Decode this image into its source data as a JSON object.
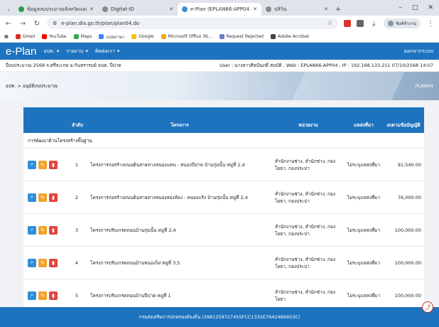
{
  "browser": {
    "tabs": [
      {
        "label": "ข้อมูลงบประมาณจังหวัดและแผนงาน",
        "icon": "globe-icon",
        "active": false
      },
      {
        "label": "Digital-ID",
        "icon": "globe-icon",
        "active": false
      },
      {
        "label": "e-Plan (EPLAN66-APP04)",
        "icon": "globe-icon",
        "active": true
      },
      {
        "label": "ปลิวิน",
        "icon": "globe-icon",
        "active": false
      }
    ],
    "url": "e-plan.dla.go.th/plan/plan04.do",
    "profile_label": "ซิงค์ทำงาน",
    "bookmarks": [
      "Gmail",
      "YouTube",
      "Maps",
      "แปลภาษา",
      "Google",
      "Microsoft Office 36...",
      "Request Rejected",
      "Adobe Acrobat"
    ],
    "new_tab_label": "+"
  },
  "app": {
    "brand": "e-Plan",
    "menu": [
      "อปท.",
      "รายงาน",
      "ติดต่อเรา"
    ],
    "logout": "ออกจากระบบ",
    "fiscal_info": "ปีงบประมาณ 2568   จ.ศรีสะเกษ อ.กันทรารมย์ อบต. ปีปาด",
    "user_info": "User : นางสาวศิลป์นภดี สมบัติ , Web : EPLAN66-APP04 , IP : 192.168.133.211 07/10/2568 14:07",
    "breadcrumb": "อปท. > อนุมัติงบประมาณ",
    "page_code": "PLAN04"
  },
  "table": {
    "headers": {
      "index": "ลำดับ",
      "project": "โครงการ",
      "agency": "หน่วยงาน",
      "source": "แหล่งที่มา",
      "budget": "งบตามข้อบัญญัติ"
    },
    "section": "การพัฒนาด้านโครงสร้างพื้นฐาน",
    "rows": [
      {
        "index": "1",
        "project": "โครงการก่อสร้างถนนดินสายทางหนองแคน - หนองปีปาด บ้านกุ่มนั้น หมู่ที่ 2,4",
        "agency": "สำนักงานช่าง, สำนักช่าง, กองโยธา, กองประปา",
        "source": "ไม่ระบุแหล่งที่มา",
        "budget": "91,540.00"
      },
      {
        "index": "2",
        "project": "โครงการก่อสร้างถนนดินสายทางหนองสองห้อง - หนองแร้ง บ้านกุ่มนั้น หมู่ที่ 2,4",
        "agency": "สำนักงานช่าง, สำนักช่าง, กองโยธา, กองประปา",
        "source": "ไม่ระบุแหล่งที่มา",
        "budget": "76,000.00"
      },
      {
        "index": "3",
        "project": "โครงการปรับเกรดถนนบ้านกุ่มนั้น หมู่ที่ 2,4",
        "agency": "สำนักงานช่าง, สำนักช่าง, กองโยธา, กองประปา",
        "source": "ไม่ระบุแหล่งที่มา",
        "budget": "100,000.00"
      },
      {
        "index": "4",
        "project": "โครงการปรับเกรดถนนบ้านหนองไผ่ หมู่ที่ 3,5",
        "agency": "สำนักงานช่าง, สำนักช่าง, กองโยธา, กองประปา",
        "source": "ไม่ระบุแหล่งที่มา",
        "budget": "100,000.00"
      },
      {
        "index": "5",
        "project": "โครงการปรับเกรดถนนบ้านปีปาด หมู่ที่ 1",
        "agency": "สำนักงานช่าง, สำนักช่าง, กองโยธา",
        "source": "ไม่ระบุแหล่งที่มา",
        "budget": "100,000.00"
      }
    ]
  },
  "footer": "กรมส่งเสริมการปกครองท้องถิ่น (3981259727455FCC1332E7642486953C)"
}
